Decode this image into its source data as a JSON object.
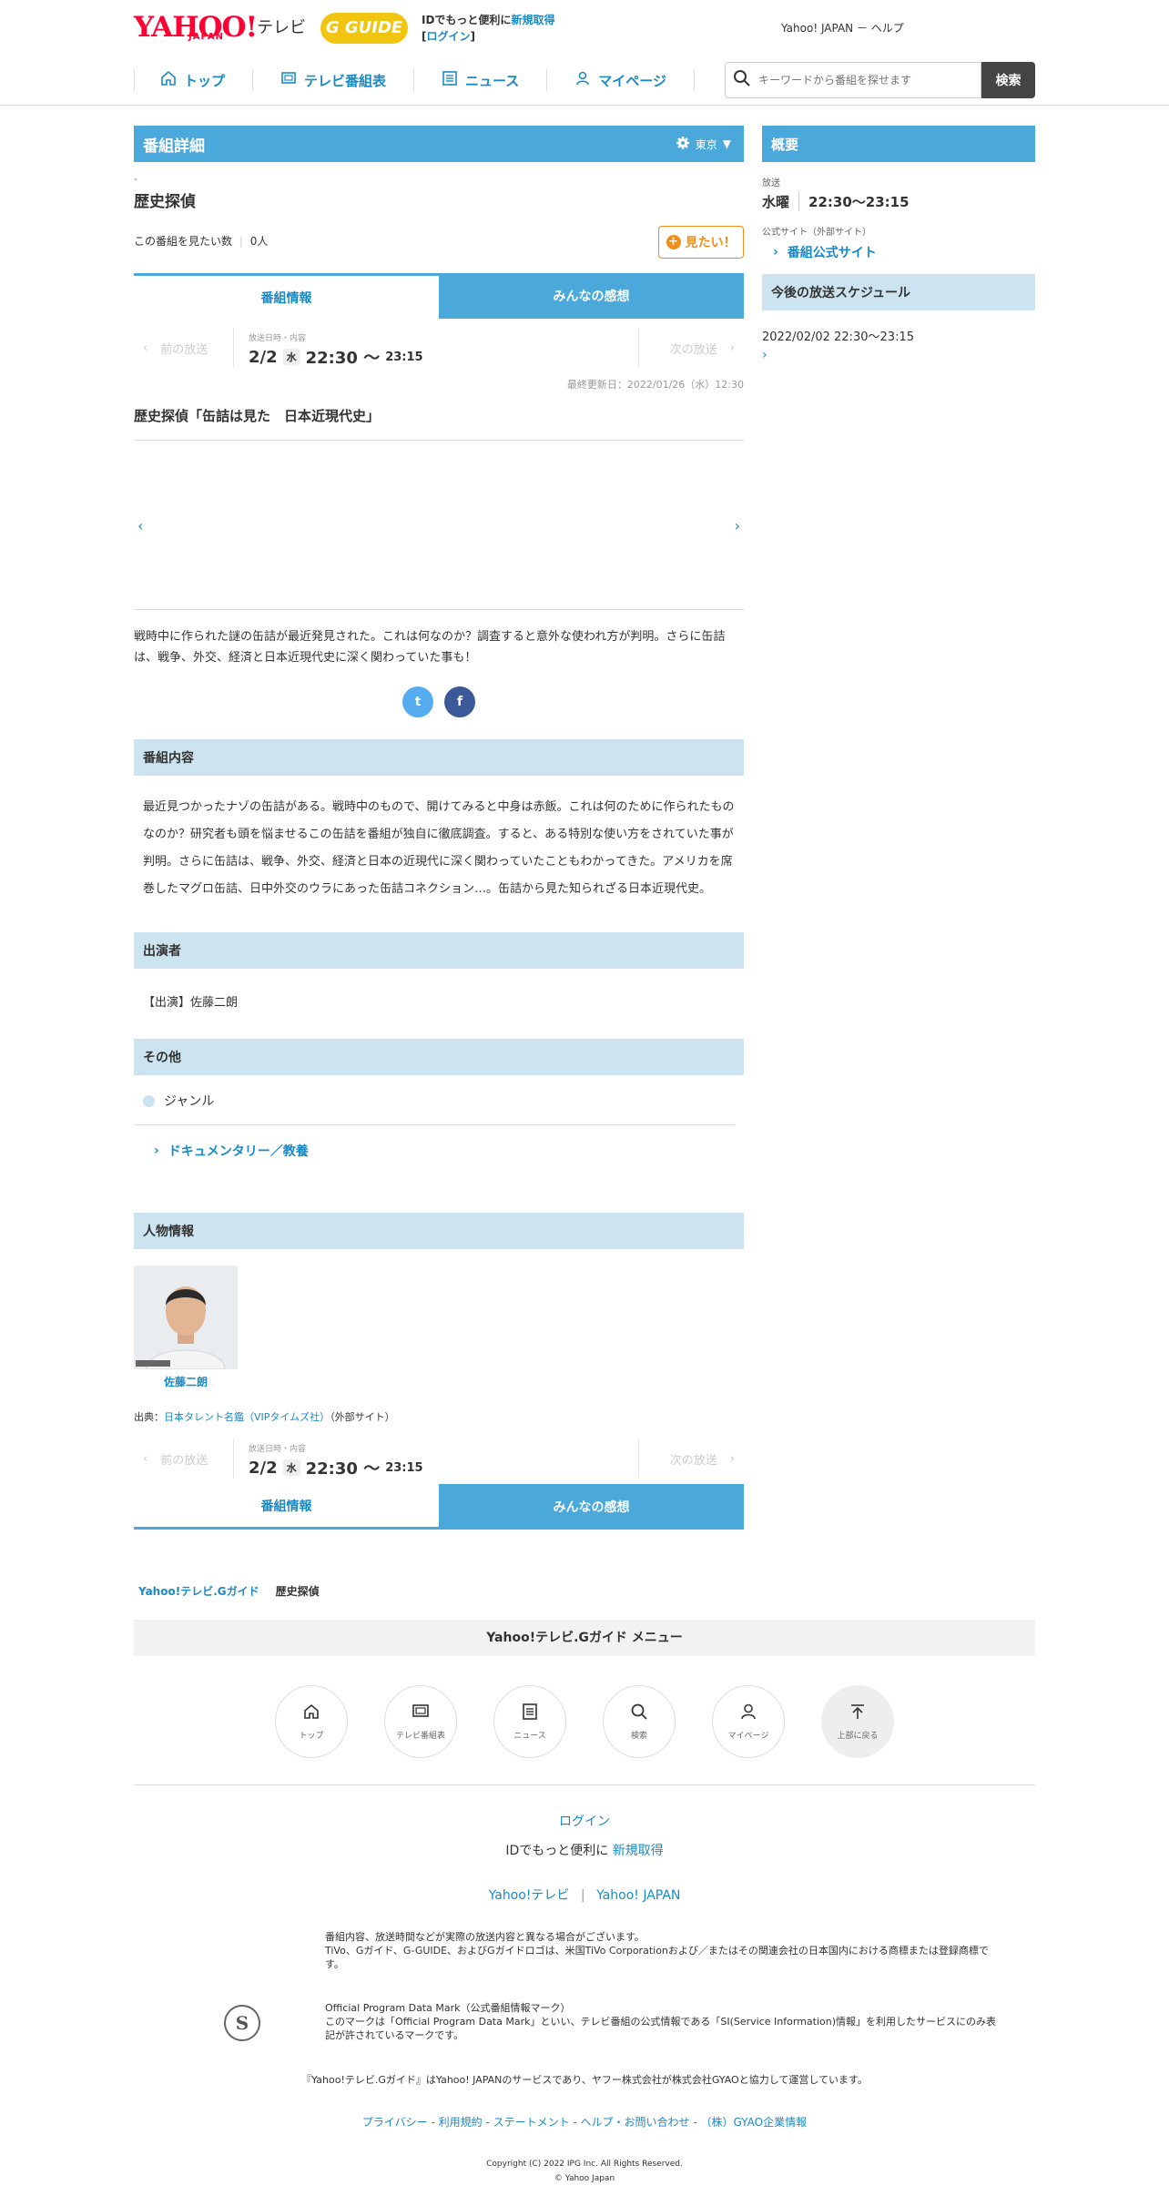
{
  "header": {
    "logo_yahoo": "YAHOO!",
    "logo_japan": "JAPAN",
    "logo_tv": "テレビ",
    "logo_gguide": "G GUIDE",
    "promo_text": "IDでもっと便利に",
    "promo_link": "新規取得",
    "login_open": "[",
    "login_link": "ログイン",
    "login_close": "]",
    "right_links": "Yahoo! JAPAN － ヘルプ",
    "nav": [
      "トップ",
      "テレビ番組表",
      "ニュース",
      "マイページ"
    ],
    "search_placeholder": "キーワードから番組を探せます",
    "search_button": "検索"
  },
  "detail": {
    "bar_title": "番組詳細",
    "area": "東京",
    "dash": "-",
    "title": "歴史探偵",
    "want_label": "この番組を見たい数",
    "want_count": "0人",
    "want_button": "見たい！",
    "tabs": [
      "番組情報",
      "みんなの感想"
    ],
    "prev": "前の放送",
    "next": "次の放送",
    "date_label": "放送日時・内容",
    "date": "2/2",
    "weekday": "水",
    "start": "22:30 〜",
    "end": "23:15",
    "updated": "最終更新日：2022/01/26（水）12:30",
    "episode_title": "歴史探偵「缶詰は見た　日本近現代史」",
    "summary": "戦時中に作られた謎の缶詰が最近発見された。これは何なのか？調査すると意外な使われ方が判明。さらに缶詰は、戦争、外交、経済と日本近現代史に深く関わっていた事も！",
    "share_twitter": "t",
    "share_facebook": "f"
  },
  "sections": {
    "content_title": "番組内容",
    "content_text": "最近見つかったナゾの缶詰がある。戦時中のもので、開けてみると中身は赤飯。これは何のために作られたものなのか？研究者も頭を悩ませるこの缶詰を番組が独自に徹底調査。すると、ある特別な使い方をされていた事が判明。さらに缶詰は、戦争、外交、経済と日本の近現代に深く関わっていたこともわかってきた。アメリカを席巻したマグロ缶詰、日中外交のウラにあった缶詰コネクション…。缶詰から見た知られざる日本近現代史。",
    "cast_title": "出演者",
    "cast_text": "【出演】佐藤二朗",
    "other_title": "その他",
    "genre_label": "ジャンル",
    "genre_value": "ドキュメンタリー／教養",
    "person_title": "人物情報",
    "person_name": "佐藤二朗",
    "source_prefix": "出典：",
    "source_link": "日本タレント名鑑（VIPタイムズ社）",
    "source_suffix": "（外部サイト）"
  },
  "side": {
    "overview": "概要",
    "broadcast_label": "放送",
    "broadcast_day": "水曜",
    "broadcast_time": "22:30～23:15",
    "official_label": "公式サイト（外部サイト）",
    "official_link": "番組公式サイト",
    "schedule_title": "今後の放送スケジュール",
    "schedule_date": "2022/02/02 22:30～23:15"
  },
  "footer": {
    "breadcrumb_home": "Yahoo!テレビ.Gガイド",
    "breadcrumb_current": "歴史探偵",
    "menu_title": "Yahoo!テレビ.Gガイド メニュー",
    "menu_items": [
      "トップ",
      "テレビ番組表",
      "ニュース",
      "検索",
      "マイページ",
      "上部に戻る"
    ],
    "login": "ログイン",
    "id_text": "IDでもっと便利に",
    "id_link": "新規取得",
    "link_tv": "Yahoo!テレビ",
    "link_sep": "|",
    "link_japan": "Yahoo! JAPAN",
    "note1": "番組内容、放送時間などが実際の放送内容と異なる場合がございます。",
    "note2": "TiVo、Gガイド、G-GUIDE、およびGガイドロゴは、米国TiVo Corporationおよび／またはその関連会社の日本国内における商標または登録商標です。",
    "opdm_title": "Official Program Data Mark（公式番組情報マーク）",
    "opdm_text": "このマークは「Official Program Data Mark」といい、テレビ番組の公式情報である「SI(Service Information)情報」を利用したサービスにのみ表記が許されているマークです。",
    "opdm_symbol": "S",
    "operate": "『Yahoo!テレビ.Gガイド』はYahoo! JAPANのサービスであり、ヤフー株式会社が株式会社GYAOと協力して運営しています。",
    "legal": "プライバシー - 利用規約 - ステートメント - ヘルプ・お問い合わせ - （株）GYAO企業情報",
    "copy1": "Copyright (C) 2022 IPG Inc. All Rights Reserved.",
    "copy2": "© Yahoo Japan"
  },
  "colors": {
    "primary": "#4aa8db",
    "light": "#cce4f0",
    "link": "#1a8ac6",
    "orange": "#f08c1a"
  }
}
